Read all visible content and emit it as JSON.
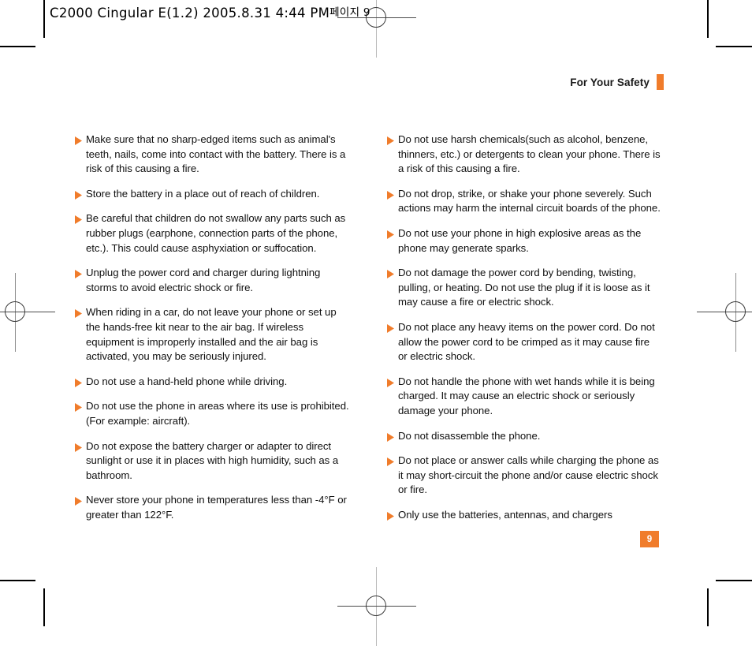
{
  "page": {
    "slug_line": "C2000 Cingular  E(1.2)  2005.8.31 4:44 PM",
    "slug_line_suffix": "페이지 9",
    "running_head": "For Your Safety",
    "page_number": "9",
    "accent_color": "#F07C2B",
    "bullet_icon": "triangle-right-icon"
  },
  "left_column": {
    "items": [
      "Make sure that no sharp-edged items such as animal's teeth, nails, come into contact with the battery. There is a risk of this causing a fire.",
      "Store the battery in a place out of reach of children.",
      "Be careful that children do not swallow any parts such as rubber plugs (earphone, connection parts of the phone, etc.). This could cause asphyxiation or suffocation.",
      "Unplug the power cord and charger during lightning storms to avoid electric shock or fire.",
      "When riding in a car, do not leave your phone or set up the hands-free kit near to the air bag. If wireless equipment is improperly installed and the air bag is activated, you may be seriously injured.",
      "Do not use a hand-held phone while driving.",
      "Do not use the phone in areas where its use is prohibited. (For example: aircraft).",
      "Do not expose the battery charger or adapter to direct sunlight or use it in places with high humidity, such as a bathroom.",
      "Never store your phone in temperatures less than -4°F or greater than 122°F."
    ]
  },
  "right_column": {
    "items": [
      "Do not use harsh chemicals(such as alcohol, benzene, thinners, etc.) or detergents to clean your phone. There is a risk of this causing a fire.",
      "Do not drop, strike, or shake your phone severely. Such actions may harm the internal circuit boards of the phone.",
      "Do not use your phone in high explosive areas as the phone may generate sparks.",
      "Do not damage the power cord by bending, twisting, pulling, or heating. Do not use the plug if it is loose as it may cause a fire or electric shock.",
      "Do not place any heavy items on the power cord. Do not allow the power cord to be crimped as it may cause fire or electric shock.",
      "Do not handle the phone with wet hands while it is being charged. It may cause an electric shock or seriously damage your phone.",
      "Do not disassemble the phone.",
      "Do not place or answer calls while charging the phone as it may short-circuit the phone and/or cause electric shock or fire.",
      "Only use the batteries, antennas, and chargers"
    ]
  }
}
